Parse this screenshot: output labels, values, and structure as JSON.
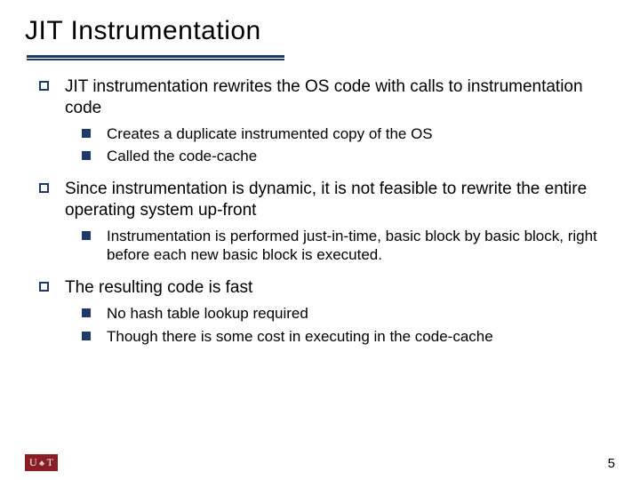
{
  "title": "JIT Instrumentation",
  "points": [
    {
      "text": "JIT instrumentation rewrites the OS code with calls to instrumentation code",
      "sub": [
        "Creates a duplicate instrumented copy of the OS",
        "Called the code-cache"
      ]
    },
    {
      "text": "Since instrumentation is dynamic, it is not feasible to rewrite the entire operating system up-front",
      "sub": [
        "Instrumentation is performed just-in-time, basic block by basic block, right before each new basic block is executed."
      ]
    },
    {
      "text": "The resulting code is fast",
      "sub": [
        "No hash table lookup required",
        "Though there is some cost in executing in the code-cache"
      ]
    }
  ],
  "logo": {
    "left": "U",
    "right": "T"
  },
  "page_number": "5"
}
